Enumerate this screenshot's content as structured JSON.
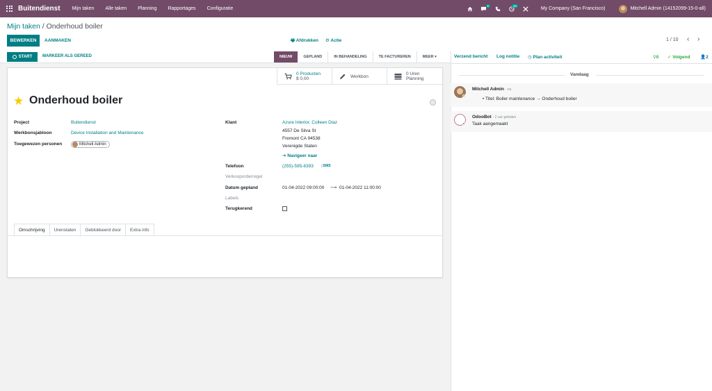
{
  "navbar": {
    "brand": "Buitendienst",
    "menu": [
      "Mijn taken",
      "Alle taken",
      "Planning",
      "Rapportages",
      "Configuratie"
    ],
    "messages_badge": "6",
    "activities_badge": "24",
    "company": "My Company (San Francisco)",
    "user": "Mitchell Admin (14152099-15-0-all)"
  },
  "breadcrumb": {
    "parent": "Mijn taken",
    "separator": "/",
    "current": "Onderhoud boiler"
  },
  "toolbar": {
    "edit_label": "BEWERKEN",
    "create_label": "AANMAKEN",
    "print_label": "Afdrukken",
    "action_label": "Actie",
    "pager": "1 / 10"
  },
  "statusbar": {
    "start_label": "START",
    "ready_label": "MARKEER ALS GEREED",
    "stages": [
      {
        "label": "NIEUW",
        "active": true
      },
      {
        "label": "GEPLAND",
        "active": false
      },
      {
        "label": "IN BEHANDELING",
        "active": false
      },
      {
        "label": "TE FACTUREREN",
        "active": false
      },
      {
        "label": "MEER",
        "active": false
      }
    ]
  },
  "smart_buttons": {
    "products_count": "0 Producten",
    "products_amount": "$ 0,00",
    "worksheet": "Werkbon",
    "hours_count": "0 Uren",
    "hours_label": "Planning"
  },
  "form": {
    "title": "Onderhoud boiler",
    "project_label": "Project",
    "project_value": "Buitendienst",
    "template_label": "Werkbonsjabloon",
    "template_value": "Device Installation and Maintenance",
    "assignees_label": "Toegewezen personen",
    "assignee": "Mitchell Admin",
    "customer_label": "Klant",
    "customer_value": "Azure Interior, Colleen Diaz",
    "address_1": "4557 De Silva St",
    "address_2": "Fremont CA 94538",
    "address_3": "Verenigde Staten",
    "navigate": "Navigeer naar",
    "phone_label": "Telefoon",
    "phone_value": "(255)-595-8393",
    "sms": "SMS",
    "sale_line_label": "Verkooporderregel",
    "planned_label": "Datum gepland",
    "planned_start": "01-04-2022 09:00:00",
    "planned_end": "01-04-2022 11:00:00",
    "labels_label": "Labels",
    "recurring_label": "Terugkerend"
  },
  "tabs": [
    "Omschrijving",
    "Urenstaten",
    "Geblokkeerd door",
    "Extra info"
  ],
  "chatter": {
    "send_message": "Verzend bericht",
    "log_note": "Log notitie",
    "plan_activity": "Plan activiteit",
    "attachments": "0",
    "follow": "Volgend",
    "followers": "2",
    "today": "Vandaag",
    "messages": [
      {
        "author": "Mitchell Admin",
        "date": "- nu",
        "text": "Titel: Boiler maintenance → Onderhoud boiler"
      },
      {
        "author": "OdooBot",
        "date": "- 2 uur geleden",
        "text": "Taak aangemaakt"
      }
    ]
  },
  "colors": {
    "brand": "#714b67",
    "accent": "#017e84",
    "star": "#f3cc00",
    "follow": "#28a745"
  }
}
